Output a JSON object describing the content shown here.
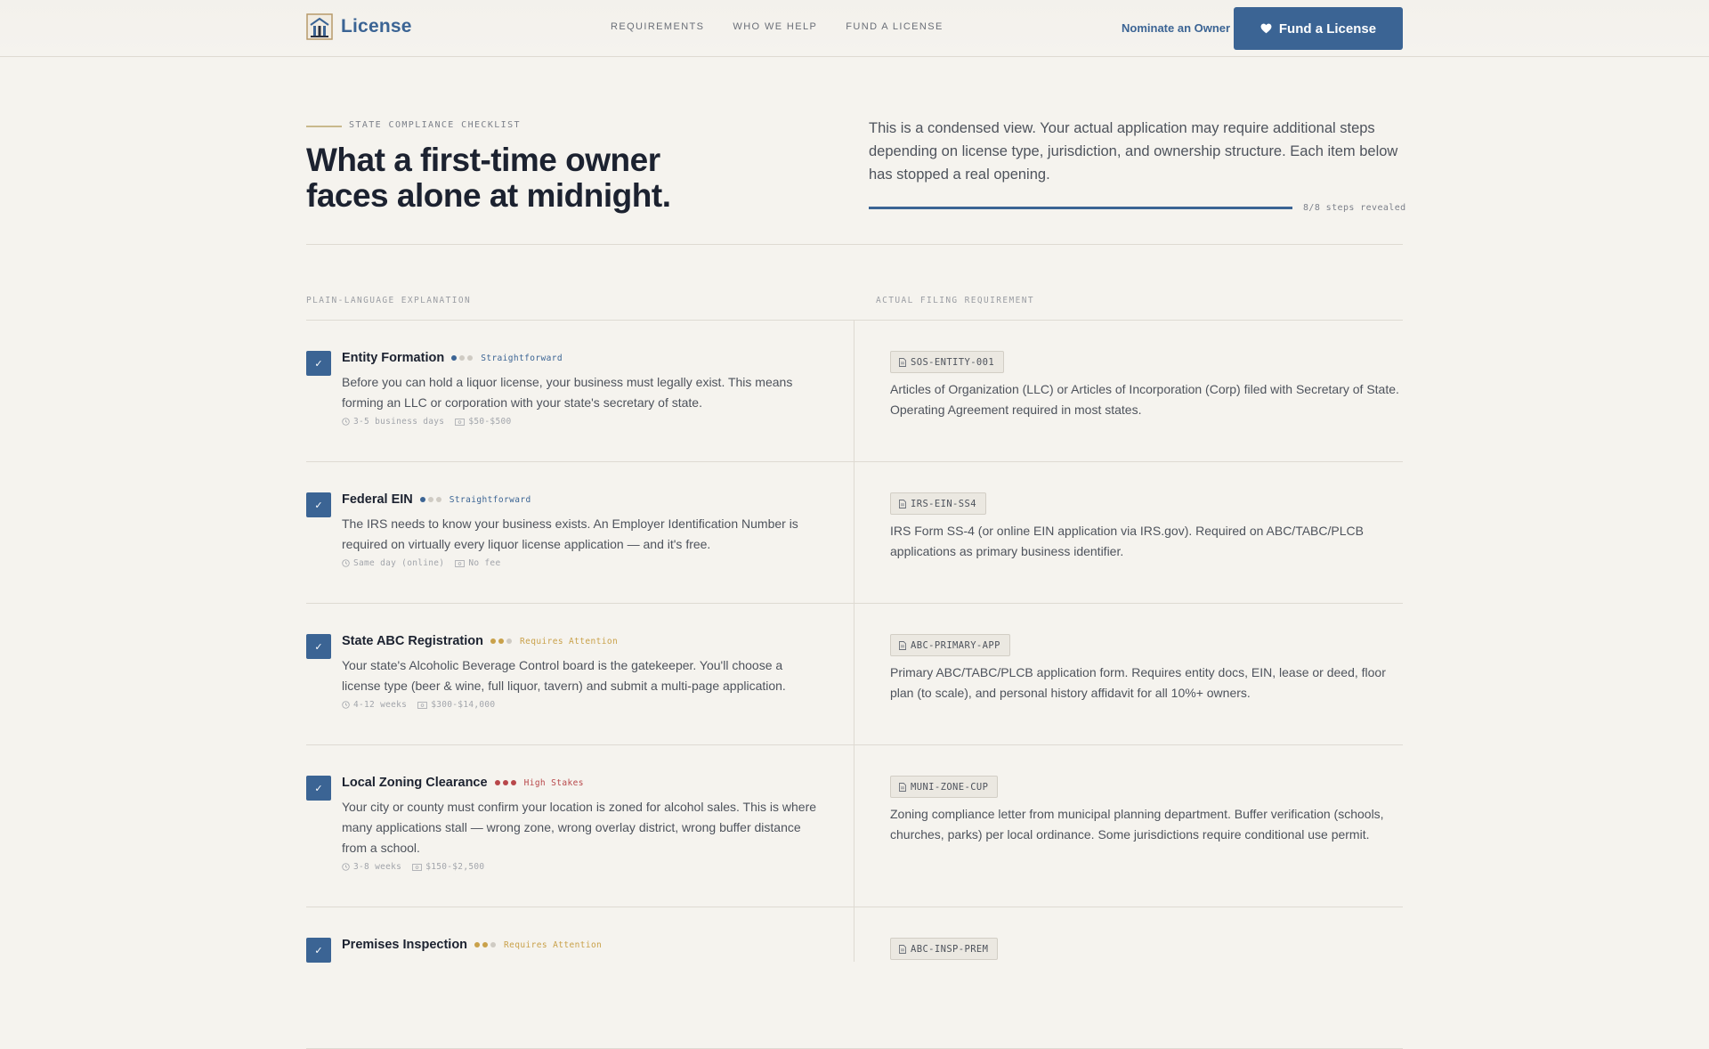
{
  "header": {
    "brand": "License",
    "nav": [
      "REQUIREMENTS",
      "WHO WE HELP",
      "FUND A LICENSE"
    ],
    "nominate": "Nominate an Owner",
    "cta": "Fund a License"
  },
  "hero": {
    "eyebrow": "STATE COMPLIANCE CHECKLIST",
    "title": "What a first-time owner faces alone at midnight.",
    "description": "This is a condensed view. Your actual application may require additional steps depending on license type, jurisdiction, and ownership structure. Each item below has stopped a real opening.",
    "progress_text": "8/8 steps revealed",
    "progress_fraction": 1.0
  },
  "table": {
    "left_header": "PLAIN-LANGUAGE EXPLANATION",
    "right_header": "ACTUAL FILING REQUIREMENT"
  },
  "colors": {
    "accent": "#3b6494",
    "straightforward": "#3b6494",
    "attention": "#c9a14a",
    "high": "#b8474a",
    "dot_off": "#cfcbc3"
  },
  "steps": [
    {
      "title": "Entity Formation",
      "level": "Straightforward",
      "level_key": "straightforward",
      "dots_filled": 1,
      "desc": "Before you can hold a liquor license, your business must legally exist. This means forming an LLC or corporation with your state's secretary of state.",
      "time": "3-5 business days",
      "fee": "$50-$500",
      "code": "SOS-ENTITY-001",
      "filing": "Articles of Organization (LLC) or Articles of Incorporation (Corp) filed with Secretary of State. Operating Agreement required in most states."
    },
    {
      "title": "Federal EIN",
      "level": "Straightforward",
      "level_key": "straightforward",
      "dots_filled": 1,
      "desc": "The IRS needs to know your business exists. An Employer Identification Number is required on virtually every liquor license application — and it's free.",
      "time": "Same day (online)",
      "fee": "No fee",
      "code": "IRS-EIN-SS4",
      "filing": "IRS Form SS-4 (or online EIN application via IRS.gov). Required on ABC/TABC/PLCB applications as primary business identifier."
    },
    {
      "title": "State ABC Registration",
      "level": "Requires Attention",
      "level_key": "attention",
      "dots_filled": 2,
      "desc": "Your state's Alcoholic Beverage Control board is the gatekeeper. You'll choose a license type (beer & wine, full liquor, tavern) and submit a multi-page application.",
      "time": "4-12 weeks",
      "fee": "$300-$14,000",
      "code": "ABC-PRIMARY-APP",
      "filing": "Primary ABC/TABC/PLCB application form. Requires entity docs, EIN, lease or deed, floor plan (to scale), and personal history affidavit for all 10%+ owners."
    },
    {
      "title": "Local Zoning Clearance",
      "level": "High Stakes",
      "level_key": "high",
      "dots_filled": 3,
      "desc": "Your city or county must confirm your location is zoned for alcohol sales. This is where many applications stall — wrong zone, wrong overlay district, wrong buffer distance from a school.",
      "time": "3-8 weeks",
      "fee": "$150-$2,500",
      "code": "MUNI-ZONE-CUP",
      "filing": "Zoning compliance letter from municipal planning department. Buffer verification (schools, churches, parks) per local ordinance. Some jurisdictions require conditional use permit."
    },
    {
      "title": "Premises Inspection",
      "level": "Requires Attention",
      "level_key": "attention",
      "dots_filled": 2,
      "desc": "",
      "time": "",
      "fee": "",
      "code": "ABC-INSP-PREM",
      "filing": ""
    }
  ]
}
